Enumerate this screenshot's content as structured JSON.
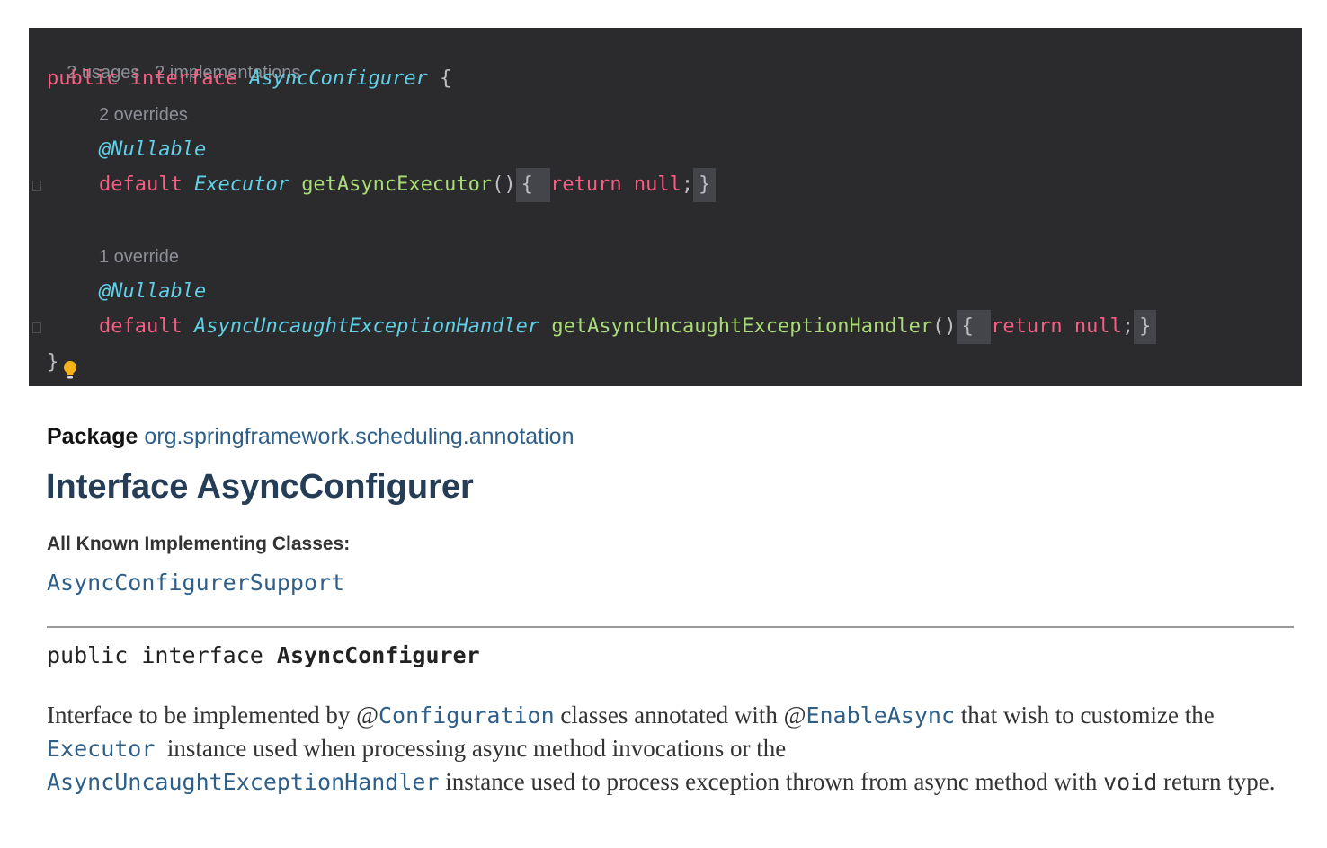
{
  "editor": {
    "lens_top": {
      "usages": "2 usages",
      "implementations": "2 implementations"
    },
    "line1": {
      "kw1": "public",
      "kw2": "interface",
      "name": "AsyncConfigurer",
      "brace": "{"
    },
    "lens_m1": "2 overrides",
    "ann1": "@Nullable",
    "m1": {
      "kw": "default",
      "type": "Executor",
      "name": "getAsyncExecutor",
      "parens": "()",
      "open": "{",
      "ret": "return",
      "nul": "null",
      "semi": ";",
      "close": "}"
    },
    "lens_m2": "1 override",
    "ann2": "@Nullable",
    "m2": {
      "kw": "default",
      "type": "AsyncUncaughtExceptionHandler",
      "name": "getAsyncUncaughtExceptionHandler",
      "parens": "()",
      "open": "{",
      "ret": "return",
      "nul": "null",
      "semi": ";",
      "close": "}"
    },
    "end_brace": "}",
    "bulb_icon": "lightbulb-icon"
  },
  "doc": {
    "package_label": "Package",
    "package_name": "org.springframework.scheduling.annotation",
    "title": "Interface AsyncConfigurer",
    "impl_heading": "All Known Implementing Classes:",
    "impl_class": "AsyncConfigurerSupport",
    "signature": {
      "prefix": "public interface",
      "name": "AsyncConfigurer"
    },
    "description": {
      "t1": "Interface to be implemented by @",
      "l1": "Configuration",
      "t2": " classes annotated with @",
      "l2": "EnableAsync",
      "t3": " that wish to customize the ",
      "l3": "Executor",
      "t4": "  instance used when processing async method invocations or the ",
      "l4": "AsyncUncaughtExceptionHandler",
      "t5": " instance used to process exception thrown from async method with ",
      "c1": "void",
      "t6": " return type."
    }
  },
  "colors": {
    "editor_bg": "#2b2b2d",
    "keyword": "#fa5c84",
    "type": "#5fd0e6",
    "function": "#a9dc76",
    "link": "#2e5f88"
  }
}
